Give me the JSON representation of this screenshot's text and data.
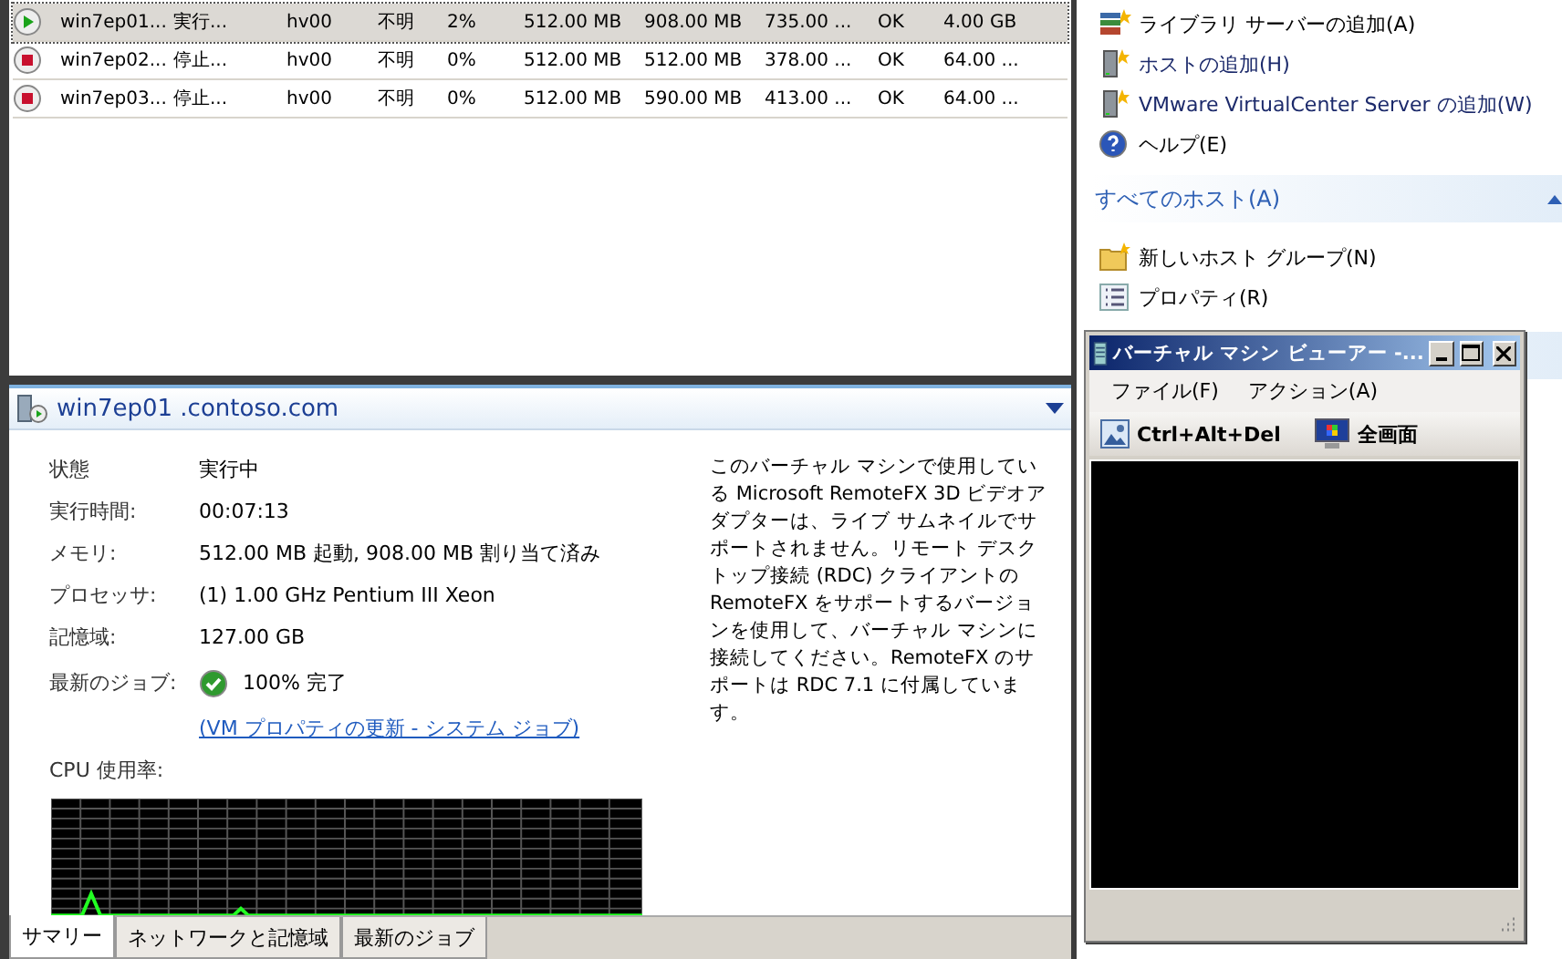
{
  "vm_table": {
    "rows": [
      {
        "kind": "running",
        "selected": true,
        "cells": [
          "win7ep01...",
          "実行...",
          "hv00",
          "不明",
          "2%",
          "512.00 MB",
          "908.00 MB",
          "735.00 ...",
          "OK",
          "4.00 GB"
        ]
      },
      {
        "kind": "stopped",
        "selected": false,
        "cells": [
          "win7ep02...",
          "停止...",
          "hv00",
          "不明",
          "0%",
          "512.00 MB",
          "512.00 MB",
          "378.00 ...",
          "OK",
          "64.00 ..."
        ]
      },
      {
        "kind": "stopped",
        "selected": false,
        "cells": [
          "win7ep03...",
          "停止...",
          "hv00",
          "不明",
          "0%",
          "512.00 MB",
          "590.00 MB",
          "413.00 ...",
          "OK",
          "64.00 ..."
        ]
      }
    ]
  },
  "details": {
    "title": "win7ep01 .contoso.com",
    "fields": [
      {
        "label": "状態",
        "value": "実行中"
      },
      {
        "label": "実行時間:",
        "value": "00:07:13"
      },
      {
        "label": "メモリ:",
        "value": "512.00 MB 起動, 908.00 MB 割り当て済み"
      },
      {
        "label": "プロセッサ:",
        "value": "(1) 1.00 GHz Pentium III Xeon"
      },
      {
        "label": "記憶域:",
        "value": "127.00 GB"
      }
    ],
    "latest_job": {
      "label": "最新のジョブ:",
      "done": true,
      "value": "100% 完了",
      "link": "(VM プロパティの更新 - システム ジョブ)"
    },
    "cpu_label": "CPU 使用率:",
    "note": "このバーチャル マシンで使用している Microsoft RemoteFX 3D ビデオアダプターは、ライブ サムネイルでサポートされません。リモート デスクトップ接続 (RDC) クライアントの RemoteFX をサポートするバージョンを使用して、バーチャル マシンに接続してください。RemoteFX のサポートは RDC 7.1 に付属しています。"
  },
  "tabs": [
    {
      "label": "サマリー",
      "selected": true
    },
    {
      "label": "ネットワークと記憶域",
      "selected": false
    },
    {
      "label": "最新のジョブ",
      "selected": false
    }
  ],
  "actions": {
    "items": [
      {
        "kind": "library",
        "label": "ライブラリ サーバーの追加(A)"
      },
      {
        "kind": "server",
        "label": "ホストの追加(H)"
      },
      {
        "kind": "server",
        "label": "VMware VirtualCenter Server の追加(W)"
      },
      {
        "kind": "help",
        "label": "ヘルプ(E)"
      }
    ],
    "sections": [
      {
        "title": "すべてのホスト(A)",
        "items": [
          {
            "kind": "folder",
            "label": "新しいホスト グループ(N)"
          },
          {
            "kind": "properties",
            "label": "プロパティ(R)"
          }
        ]
      }
    ]
  },
  "viewer": {
    "title": "バーチャル マシン ビューアー -...",
    "menu": [
      "ファイル(F)",
      "アクション(A)"
    ],
    "toolbar": [
      {
        "kind": "picture",
        "label": "Ctrl+Alt+Del"
      },
      {
        "kind": "monitor",
        "label": "全画面"
      }
    ]
  }
}
